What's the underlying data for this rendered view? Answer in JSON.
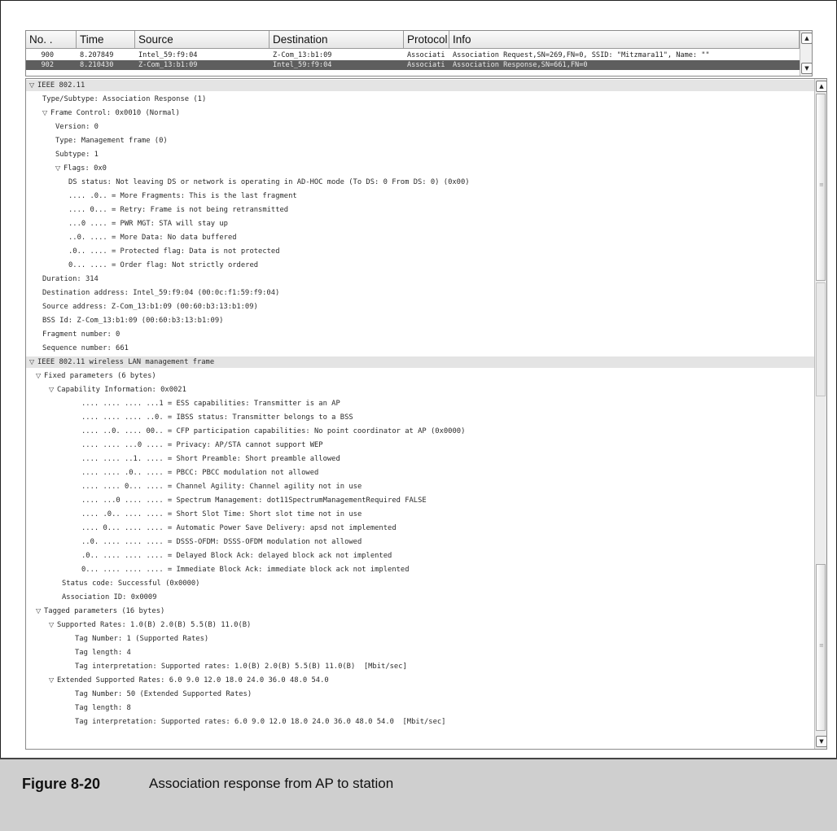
{
  "packet_list": {
    "columns": [
      "No. .",
      "Time",
      "Source",
      "Destination",
      "Protocol",
      "Info"
    ],
    "rows": [
      {
        "no": "900",
        "time": "8.207849",
        "source": "Intel_59:f9:04",
        "destination": "Z-Com_13:b1:09",
        "protocol": "Associati",
        "info": "Association Request,SN=269,FN=0, SSID: \"Mitzmara11\", Name: \"\"",
        "selected": false
      },
      {
        "no": "902",
        "time": "8.210430",
        "source": "Z-Com_13:b1:09",
        "destination": "Intel_59:f9:04",
        "protocol": "Associati",
        "info": "Association Response,SN=661,FN=0",
        "selected": true
      }
    ]
  },
  "detail_tree": {
    "lines": [
      {
        "indent": 0,
        "toggle": "open",
        "header": true,
        "text": "IEEE 802.11"
      },
      {
        "indent": 2,
        "toggle": "",
        "text": "Type/Subtype: Association Response (1)"
      },
      {
        "indent": 2,
        "toggle": "open",
        "text": "Frame Control: 0x0010 (Normal)"
      },
      {
        "indent": 4,
        "toggle": "",
        "text": "Version: 0"
      },
      {
        "indent": 4,
        "toggle": "",
        "text": "Type: Management frame (0)"
      },
      {
        "indent": 4,
        "toggle": "",
        "text": "Subtype: 1"
      },
      {
        "indent": 4,
        "toggle": "open",
        "text": "Flags: 0x0"
      },
      {
        "indent": 6,
        "toggle": "",
        "text": "DS status: Not leaving DS or network is operating in AD-HOC mode (To DS: 0 From DS: 0) (0x00)"
      },
      {
        "indent": 6,
        "toggle": "",
        "text": ".... .0.. = More Fragments: This is the last fragment"
      },
      {
        "indent": 6,
        "toggle": "",
        "text": ".... 0... = Retry: Frame is not being retransmitted"
      },
      {
        "indent": 6,
        "toggle": "",
        "text": "...0 .... = PWR MGT: STA will stay up"
      },
      {
        "indent": 6,
        "toggle": "",
        "text": "..0. .... = More Data: No data buffered"
      },
      {
        "indent": 6,
        "toggle": "",
        "text": ".0.. .... = Protected flag: Data is not protected"
      },
      {
        "indent": 6,
        "toggle": "",
        "text": "0... .... = Order flag: Not strictly ordered"
      },
      {
        "indent": 2,
        "toggle": "",
        "text": "Duration: 314"
      },
      {
        "indent": 2,
        "toggle": "",
        "text": "Destination address: Intel_59:f9:04 (00:0c:f1:59:f9:04)"
      },
      {
        "indent": 2,
        "toggle": "",
        "text": "Source address: Z-Com_13:b1:09 (00:60:b3:13:b1:09)"
      },
      {
        "indent": 2,
        "toggle": "",
        "text": "BSS Id: Z-Com_13:b1:09 (00:60:b3:13:b1:09)"
      },
      {
        "indent": 2,
        "toggle": "",
        "text": "Fragment number: 0"
      },
      {
        "indent": 2,
        "toggle": "",
        "text": "Sequence number: 661"
      },
      {
        "indent": 0,
        "toggle": "open",
        "header": true,
        "text": "IEEE 802.11 wireless LAN management frame"
      },
      {
        "indent": 1,
        "toggle": "open",
        "text": "Fixed parameters (6 bytes)"
      },
      {
        "indent": 3,
        "toggle": "open",
        "text": "Capability Information: 0x0021"
      },
      {
        "indent": 8,
        "toggle": "",
        "text": ".... .... .... ...1 = ESS capabilities: Transmitter is an AP"
      },
      {
        "indent": 8,
        "toggle": "",
        "text": ".... .... .... ..0. = IBSS status: Transmitter belongs to a BSS"
      },
      {
        "indent": 8,
        "toggle": "",
        "text": ".... ..0. .... 00.. = CFP participation capabilities: No point coordinator at AP (0x0000)"
      },
      {
        "indent": 8,
        "toggle": "",
        "text": ".... .... ...0 .... = Privacy: AP/STA cannot support WEP"
      },
      {
        "indent": 8,
        "toggle": "",
        "text": ".... .... ..1. .... = Short Preamble: Short preamble allowed"
      },
      {
        "indent": 8,
        "toggle": "",
        "text": ".... .... .0.. .... = PBCC: PBCC modulation not allowed"
      },
      {
        "indent": 8,
        "toggle": "",
        "text": ".... .... 0... .... = Channel Agility: Channel agility not in use"
      },
      {
        "indent": 8,
        "toggle": "",
        "text": ".... ...0 .... .... = Spectrum Management: dot11SpectrumManagementRequired FALSE"
      },
      {
        "indent": 8,
        "toggle": "",
        "text": ".... .0.. .... .... = Short Slot Time: Short slot time not in use"
      },
      {
        "indent": 8,
        "toggle": "",
        "text": ".... 0... .... .... = Automatic Power Save Delivery: apsd not implemented"
      },
      {
        "indent": 8,
        "toggle": "",
        "text": "..0. .... .... .... = DSSS-OFDM: DSSS-OFDM modulation not allowed"
      },
      {
        "indent": 8,
        "toggle": "",
        "text": ".0.. .... .... .... = Delayed Block Ack: delayed block ack not implented"
      },
      {
        "indent": 8,
        "toggle": "",
        "text": "0... .... .... .... = Immediate Block Ack: immediate block ack not implented"
      },
      {
        "indent": 5,
        "toggle": "",
        "text": "Status code: Successful (0x0000)"
      },
      {
        "indent": 5,
        "toggle": "",
        "text": "Association ID: 0x0009"
      },
      {
        "indent": 1,
        "toggle": "open",
        "text": "Tagged parameters (16 bytes)"
      },
      {
        "indent": 3,
        "toggle": "open",
        "text": "Supported Rates: 1.0(B) 2.0(B) 5.5(B) 11.0(B)"
      },
      {
        "indent": 7,
        "toggle": "",
        "text": "Tag Number: 1 (Supported Rates)"
      },
      {
        "indent": 7,
        "toggle": "",
        "text": "Tag length: 4"
      },
      {
        "indent": 7,
        "toggle": "",
        "text": "Tag interpretation: Supported rates: 1.0(B) 2.0(B) 5.5(B) 11.0(B)  [Mbit/sec]"
      },
      {
        "indent": 3,
        "toggle": "open",
        "text": "Extended Supported Rates: 6.0 9.0 12.0 18.0 24.0 36.0 48.0 54.0"
      },
      {
        "indent": 7,
        "toggle": "",
        "text": "Tag Number: 50 (Extended Supported Rates)"
      },
      {
        "indent": 7,
        "toggle": "",
        "text": "Tag length: 8"
      },
      {
        "indent": 7,
        "toggle": "",
        "text": "Tag interpretation: Supported rates: 6.0 9.0 12.0 18.0 24.0 36.0 48.0 54.0  [Mbit/sec]"
      }
    ]
  },
  "caption": {
    "figure": "Figure 8-20",
    "text": "Association response from AP to station"
  },
  "icons": {
    "toggle_open": "triangle-down-icon",
    "scroll_up": "arrow-up-icon",
    "scroll_down": "arrow-down-icon"
  },
  "colors": {
    "selected_row": "#5e5e5e",
    "section_header": "#e4e4e4",
    "caption_bg": "#cfcfcf"
  }
}
